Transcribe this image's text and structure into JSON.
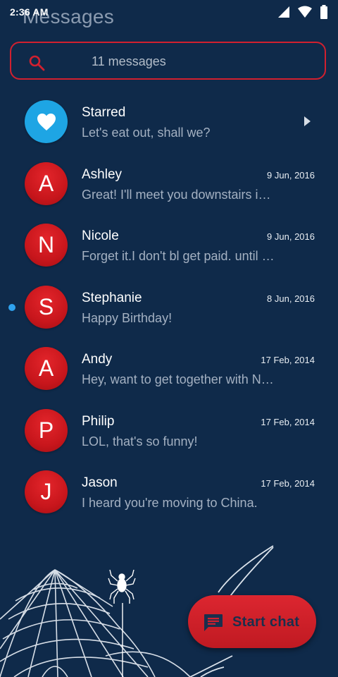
{
  "status_bar": {
    "time": "2:36 AM",
    "icons": [
      "signal-icon",
      "wifi-icon",
      "battery-icon"
    ]
  },
  "header": {
    "title": "Messages"
  },
  "search": {
    "placeholder": "11 messages",
    "icon": "search-icon"
  },
  "conversations": [
    {
      "name": "Starred",
      "snippet": "Let's eat out, shall we?",
      "date": "",
      "avatar": "heart-icon",
      "unread": false,
      "has_chevron": true
    },
    {
      "name": "Ashley",
      "snippet": "Great! I'll meet you downstairs i…",
      "date": "9 Jun, 2016",
      "avatar": "A",
      "unread": false
    },
    {
      "name": "Nicole",
      "snippet": "Forget it.I don't bl get paid. until …",
      "date": "9 Jun, 2016",
      "avatar": "N",
      "unread": false
    },
    {
      "name": "Stephanie",
      "snippet": "Happy Birthday!",
      "date": "8 Jun, 2016",
      "avatar": "S",
      "unread": true
    },
    {
      "name": "Andy",
      "snippet": "Hey, want to get together with N…",
      "date": "17 Feb, 2014",
      "avatar": "A",
      "unread": false
    },
    {
      "name": "Philip",
      "snippet": "LOL, that's so funny!",
      "date": "17 Feb, 2014",
      "avatar": "P",
      "unread": false
    },
    {
      "name": "Jason",
      "snippet": "I heard you're moving to China.",
      "date": "17 Feb, 2014",
      "avatar": "J",
      "unread": false
    }
  ],
  "fab": {
    "label": "Start chat",
    "icon": "chat-icon"
  },
  "colors": {
    "background": "#0f2a4a",
    "accent_red": "#d1202f",
    "starred_blue": "#1ea5e4",
    "unread_dot": "#2fa3ef"
  }
}
